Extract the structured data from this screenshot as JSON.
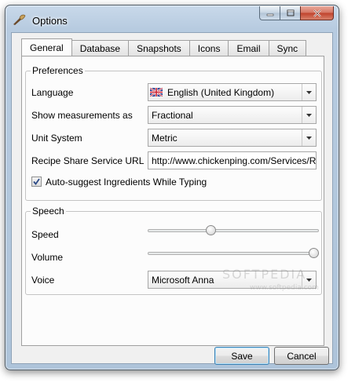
{
  "window": {
    "title": "Options",
    "icon": "app-icon",
    "caption_buttons": [
      "minimize-icon",
      "maximize-icon",
      "close-icon"
    ]
  },
  "tabs": [
    {
      "label": "General",
      "active": true
    },
    {
      "label": "Database",
      "active": false
    },
    {
      "label": "Snapshots",
      "active": false
    },
    {
      "label": "Icons",
      "active": false
    },
    {
      "label": "Email",
      "active": false
    },
    {
      "label": "Sync",
      "active": false
    }
  ],
  "preferences": {
    "legend": "Preferences",
    "language_label": "Language",
    "language_value": "English (United Kingdom)",
    "measurements_label": "Show measurements as",
    "measurements_value": "Fractional",
    "unit_label": "Unit System",
    "unit_value": "Metric",
    "url_label": "Recipe Share Service URL",
    "url_value": "http://www.chickenping.com/Services/RecipeShare",
    "autosuggest_label": "Auto-suggest Ingredients While Typing",
    "autosuggest_checked": true
  },
  "speech": {
    "legend": "Speech",
    "speed_label": "Speed",
    "speed_level": 0.36,
    "volume_label": "Volume",
    "volume_level": 1.0,
    "voice_label": "Voice",
    "voice_value": "Microsoft Anna"
  },
  "buttons": {
    "save": "Save",
    "cancel": "Cancel"
  },
  "watermark": {
    "big": "SOFTPEDIA",
    "small": "www.softpedia.com"
  },
  "colors": {
    "frame": "#b7cbe0",
    "close_button": "#c0412b",
    "default_button_border": "#3c7fb1"
  }
}
